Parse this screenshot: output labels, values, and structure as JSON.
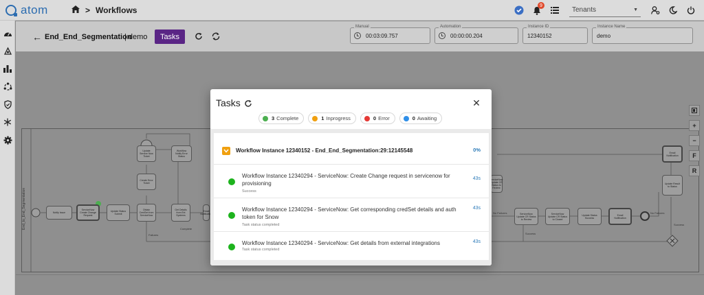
{
  "app": {
    "logo_text": "atom",
    "brand_color": "#2b6cb0"
  },
  "breadcrumb": {
    "home_icon": "home-icon",
    "separator": ">",
    "current": "Workflows"
  },
  "topbar": {
    "notification_count": "9",
    "tenants_placeholder": "Tenants",
    "icons": [
      "help-badge-icon",
      "bell-icon",
      "list-icon",
      "user-settings-icon",
      "dark-mode-icon",
      "power-icon"
    ]
  },
  "leftnav": {
    "icons": [
      "dashboard-icon",
      "devices-icon",
      "chart-icon",
      "topology-icon",
      "shield-icon",
      "snowflake-icon",
      "gear-icon"
    ]
  },
  "header": {
    "workflow_name": "End_End_Segmentation",
    "instance_suffix": "| demo",
    "tasks_button": "Tasks",
    "fields": [
      {
        "label": "Manual",
        "value": "00:03:09.757"
      },
      {
        "label": "Automation",
        "value": "00:00:00.204"
      },
      {
        "label": "Instance ID",
        "value": "12340152"
      },
      {
        "label": "Instance Name",
        "value": "demo"
      }
    ]
  },
  "canvas": {
    "lane_label": "End_to_End_Segmentation",
    "side_tools": [
      "F",
      "R"
    ],
    "nodes": [
      "Notify Issue",
      "ServiceNow Create Change Request",
      "Update Status Submit",
      "Obtain CredSet from ServiceNow",
      "Get Details from Ext Systems",
      "Create Error Ticket",
      "Update Service Now Ticket",
      "Workflow Notify Error Status",
      "Email Notification",
      "ServiceNow Update CR Status to Review",
      "ServiceNow Update CR Status to Closed",
      "Update Status Success",
      "Email Notification",
      "Email Notification",
      "Update Result to Status",
      "ServiceNow Update CR Status to Review"
    ],
    "edge_labels": [
      "Failures",
      "Complete",
      "No Failures",
      "Success",
      "No Failures",
      "Success"
    ]
  },
  "modal": {
    "title": "Tasks",
    "summary": [
      {
        "count": "3",
        "label": "Complete",
        "color": "#4caf50"
      },
      {
        "count": "1",
        "label": "Inprogress",
        "color": "#f0a010"
      },
      {
        "count": "0",
        "label": "Error",
        "color": "#e53935"
      },
      {
        "count": "0",
        "label": "Awaiting",
        "color": "#2f8fe8"
      }
    ],
    "group": {
      "title": "Workflow Instance 12340152 - End_End_Segmentation:29:12145548",
      "percent": "0%"
    },
    "tasks": [
      {
        "name": "Workflow Instance 12340294 - ServiceNow: Create Change request in servicenow for provisioning",
        "status": "Success",
        "time": "43s",
        "color": "#1db31d"
      },
      {
        "name": "Workflow Instance 12340294 - ServiceNow: Get corresponding credSet details and auth token for Snow",
        "status": "Task status completed",
        "time": "43s",
        "color": "#1db31d"
      },
      {
        "name": "Workflow Instance 12340294 - ServiceNow: Get details from external integrations",
        "status": "Task status completed",
        "time": "43s",
        "color": "#1db31d"
      }
    ]
  }
}
